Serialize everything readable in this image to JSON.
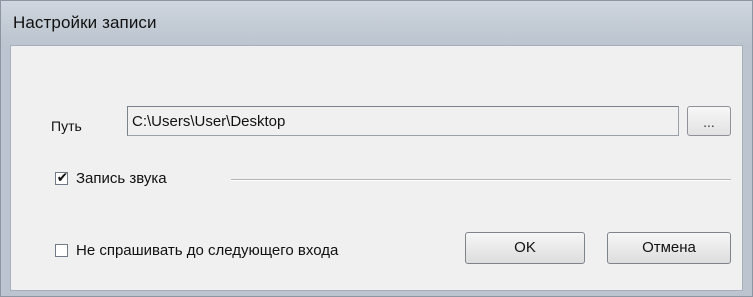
{
  "window": {
    "title": "Настройки записи"
  },
  "path": {
    "label": "Путь",
    "value": "C:\\Users\\User\\Desktop",
    "browse_label": "..."
  },
  "sound": {
    "label": "Запись звука",
    "checked": true,
    "check_glyph": "✔"
  },
  "dont_ask": {
    "label": "Не спрашивать до следующего входа",
    "checked": false
  },
  "buttons": {
    "ok": "OK",
    "cancel": "Отмена"
  }
}
